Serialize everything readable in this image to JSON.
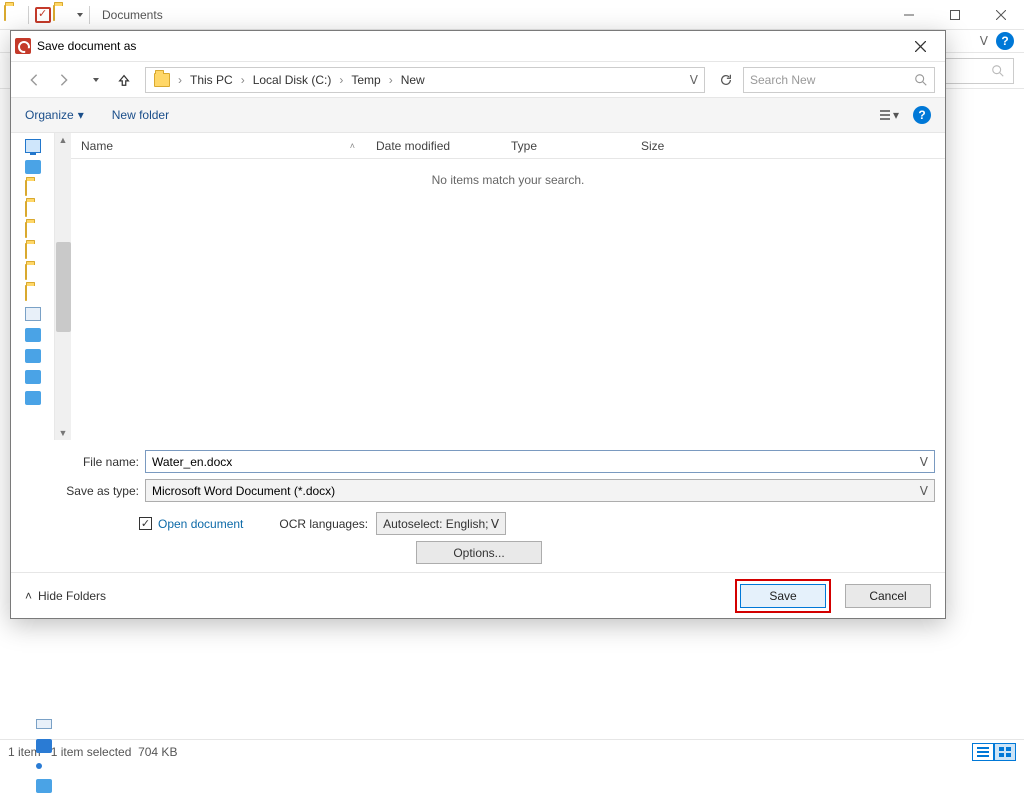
{
  "explorer": {
    "title": "Documents",
    "status": {
      "count": "1 item",
      "selection": "1 item selected",
      "size": "704 KB"
    },
    "help_caret": "ᐯ"
  },
  "dialog": {
    "title": "Save document as",
    "breadcrumb": [
      "This PC",
      "Local Disk (C:)",
      "Temp",
      "New"
    ],
    "search_placeholder": "Search New",
    "toolbar": {
      "organize": "Organize",
      "new_folder": "New folder"
    },
    "columns": {
      "name": "Name",
      "date": "Date modified",
      "type": "Type",
      "size": "Size"
    },
    "empty_msg": "No items match your search.",
    "file_name_label": "File name:",
    "file_name_value": "Water_en.docx",
    "save_type_label": "Save as type:",
    "save_type_value": "Microsoft Word Document (*.docx)",
    "open_doc_label": "Open document",
    "open_doc_checked": true,
    "ocr_lang_label": "OCR languages:",
    "ocr_lang_value": "Autoselect: English; G",
    "options_label": "Options...",
    "hide_folders": "Hide Folders",
    "save": "Save",
    "cancel": "Cancel"
  }
}
